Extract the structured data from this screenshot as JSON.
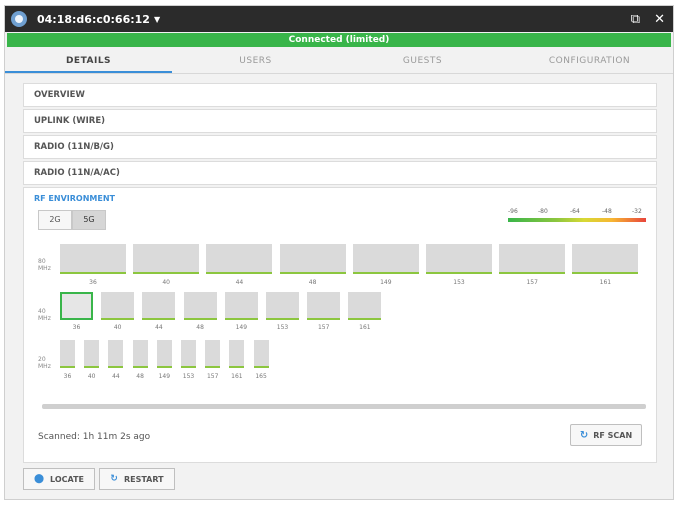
{
  "titlebar": {
    "device_name": "04:18:d6:c0:66:12",
    "caret": "▼",
    "popout_icon": "popout-icon",
    "close_icon": "close-icon",
    "popout_glyph": "⧉",
    "close_glyph": "✕"
  },
  "status": {
    "text": "Connected (limited)",
    "color": "#39b54a"
  },
  "tabs": [
    {
      "label": "DETAILS",
      "active": true
    },
    {
      "label": "USERS"
    },
    {
      "label": "GUESTS"
    },
    {
      "label": "CONFIGURATION"
    }
  ],
  "sections": [
    {
      "label": "OVERVIEW"
    },
    {
      "label": "UPLINK (WIRE)"
    },
    {
      "label": "RADIO (11N/B/G)"
    },
    {
      "label": "RADIO (11N/A/AC)"
    }
  ],
  "rf": {
    "title": "RF ENVIRONMENT",
    "bands": [
      {
        "label": "2G"
      },
      {
        "label": "5G",
        "active": true
      }
    ],
    "rssi_scale": [
      "-96",
      "-80",
      "-64",
      "-48",
      "-32"
    ],
    "rows": [
      {
        "label": "80 MHz",
        "channels": [
          "36",
          "40",
          "44",
          "48",
          "149",
          "153",
          "157",
          "161"
        ]
      },
      {
        "label": "40 MHz",
        "channels": [
          "36",
          "40",
          "44",
          "48",
          "149",
          "153",
          "157",
          "161"
        ],
        "selected_index": 0
      },
      {
        "label": "20 MHz",
        "channels": [
          "36",
          "40",
          "44",
          "48",
          "149",
          "153",
          "157",
          "161",
          "165"
        ]
      }
    ],
    "scanned_text": "Scanned: 1h 11m 2s ago",
    "scan_button": "RF SCAN",
    "scan_icon": "refresh-icon"
  },
  "footer": {
    "locate": "LOCATE",
    "locate_icon": "location-pin-icon",
    "restart": "RESTART",
    "restart_icon": "refresh-icon"
  },
  "colors": {
    "accent": "#3a8ed8",
    "titlebar": "#2b2b2b",
    "good": "#8cc63f"
  }
}
